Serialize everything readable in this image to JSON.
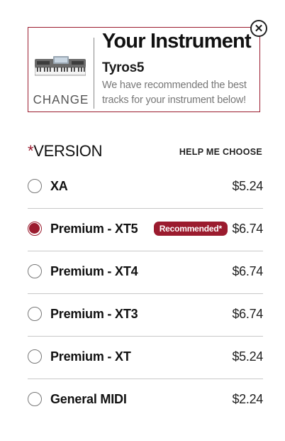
{
  "instrument": {
    "title": "Your Instrument",
    "name": "Tyros5",
    "description": "We have recommended the best tracks for your instrument below!",
    "change_label": "CHANGE",
    "close_symbol": "✕"
  },
  "version": {
    "asterisk": "*",
    "label": "VERSION",
    "help_label": "HELP ME CHOOSE",
    "options": [
      {
        "name": "XA",
        "price": "$5.24",
        "selected": false,
        "badge": ""
      },
      {
        "name": "Premium - XT5",
        "price": "$6.74",
        "selected": true,
        "badge": "Recommended*"
      },
      {
        "name": "Premium - XT4",
        "price": "$6.74",
        "selected": false,
        "badge": ""
      },
      {
        "name": "Premium - XT3",
        "price": "$6.74",
        "selected": false,
        "badge": ""
      },
      {
        "name": "Premium - XT",
        "price": "$5.24",
        "selected": false,
        "badge": ""
      },
      {
        "name": "General MIDI",
        "price": "$2.24",
        "selected": false,
        "badge": ""
      }
    ]
  },
  "colors": {
    "accent": "#9b1b2e",
    "divider": "#c8c8c8"
  },
  "icons": {
    "close": "close-icon",
    "keyboard": "keyboard-image",
    "radio": "radio-button"
  }
}
